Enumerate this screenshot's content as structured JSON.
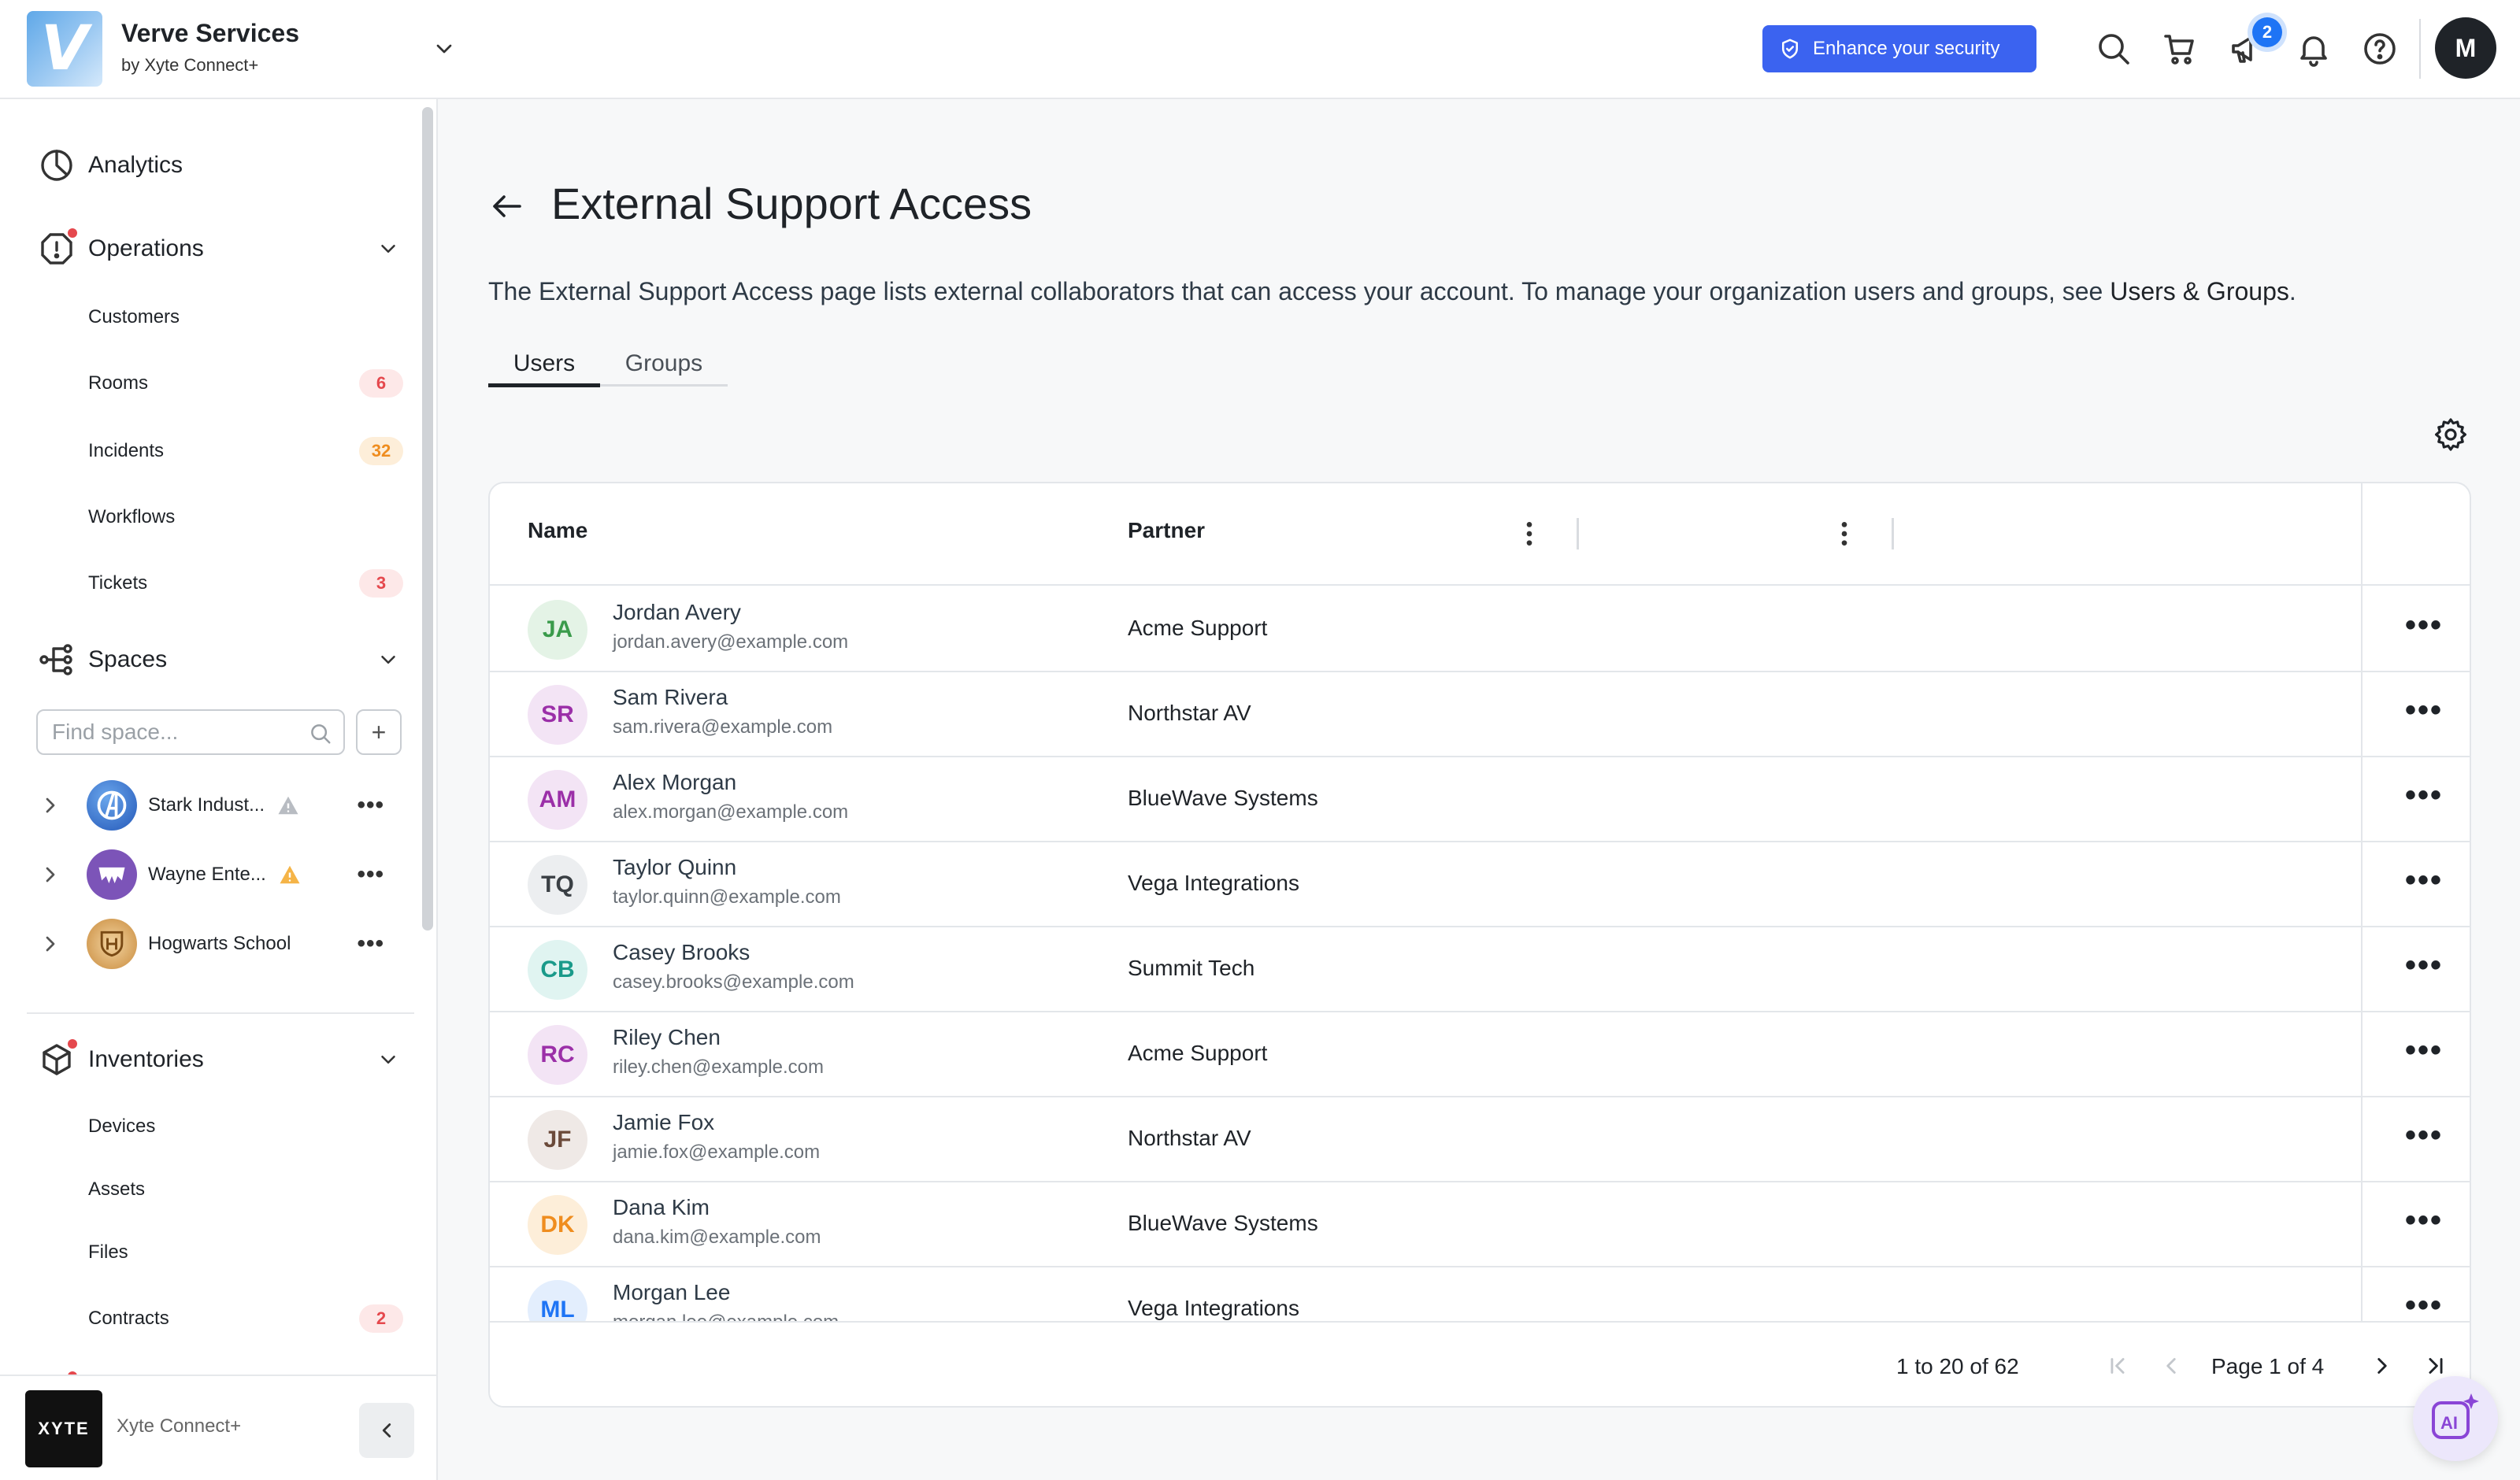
{
  "header": {
    "app_name": "Verve Services",
    "app_sub": "by Xyte Connect+",
    "logo_letter": "V",
    "security_button": "Enhance your security",
    "notification_count": "2",
    "user_initial": "M",
    "accent_color": "#3b63f0"
  },
  "sidebar": {
    "analytics": "Analytics",
    "operations": {
      "label": "Operations",
      "items": [
        {
          "label": "Customers",
          "count": ""
        },
        {
          "label": "Rooms",
          "count": "6"
        },
        {
          "label": "Incidents",
          "count": "32"
        },
        {
          "label": "Workflows",
          "count": ""
        },
        {
          "label": "Tickets",
          "count": "3"
        }
      ]
    },
    "spaces": {
      "label": "Spaces",
      "search_placeholder": "Find space...",
      "add_label": "+",
      "items": [
        {
          "name": "Stark Indust...",
          "warning": "gray"
        },
        {
          "name": "Wayne Ente...",
          "warning": "orange"
        },
        {
          "name": "Hogwarts School",
          "warning": ""
        }
      ]
    },
    "inventories": {
      "label": "Inventories",
      "items": [
        {
          "label": "Devices",
          "count": ""
        },
        {
          "label": "Assets",
          "count": ""
        },
        {
          "label": "Files",
          "count": ""
        },
        {
          "label": "Contracts",
          "count": "2"
        }
      ]
    },
    "footer": {
      "logo_text": "XYTE",
      "name": "Xyte Connect+"
    }
  },
  "main": {
    "title": "External Support Access",
    "description": "The External Support Access page lists external collaborators that can access your account. To manage your organization users and groups, see ",
    "description_link": "Users & Groups",
    "description_end": ".",
    "tabs": [
      {
        "label": "Users",
        "active": true
      },
      {
        "label": "Groups",
        "active": false
      }
    ],
    "table": {
      "columns": [
        "Name",
        "Partner"
      ],
      "rows": [
        {
          "initials": "JA",
          "name": "Jordan Avery",
          "email": "jordan.avery@example.com",
          "partner": "Acme Support",
          "color": "#3a9b4b",
          "bg": "#e4f3e6"
        },
        {
          "initials": "SR",
          "name": "Sam Rivera",
          "email": "sam.rivera@example.com",
          "partner": "Northstar AV",
          "color": "#9b2fa8",
          "bg": "#f3e4f5"
        },
        {
          "initials": "AM",
          "name": "Alex Morgan",
          "email": "alex.morgan@example.com",
          "partner": "BlueWave Systems",
          "color": "#9b2fa8",
          "bg": "#f3e4f5"
        },
        {
          "initials": "TQ",
          "name": "Taylor Quinn",
          "email": "taylor.quinn@example.com",
          "partner": "Vega Integrations",
          "color": "#3a3f44",
          "bg": "#eceef0"
        },
        {
          "initials": "CB",
          "name": "Casey Brooks",
          "email": "casey.brooks@example.com",
          "partner": "Summit Tech",
          "color": "#1a9a8a",
          "bg": "#e0f4f1"
        },
        {
          "initials": "RC",
          "name": "Riley Chen",
          "email": "riley.chen@example.com",
          "partner": "Acme Support",
          "color": "#9b2fa8",
          "bg": "#f3e4f5"
        },
        {
          "initials": "JF",
          "name": "Jamie Fox",
          "email": "jamie.fox@example.com",
          "partner": "Northstar AV",
          "color": "#6b4a3a",
          "bg": "#efe9e6"
        },
        {
          "initials": "DK",
          "name": "Dana Kim",
          "email": "dana.kim@example.com",
          "partner": "BlueWave Systems",
          "color": "#ef8d1f",
          "bg": "#fdeed9"
        },
        {
          "initials": "ML",
          "name": "Morgan Lee",
          "email": "morgan.lee@example.com",
          "partner": "Vega Integrations",
          "color": "#1e74f5",
          "bg": "#e3eefd"
        }
      ]
    },
    "pagination": {
      "range": "1 to 20 of 62",
      "page_label": "Page 1 of 4"
    }
  },
  "ai_button": "AI"
}
